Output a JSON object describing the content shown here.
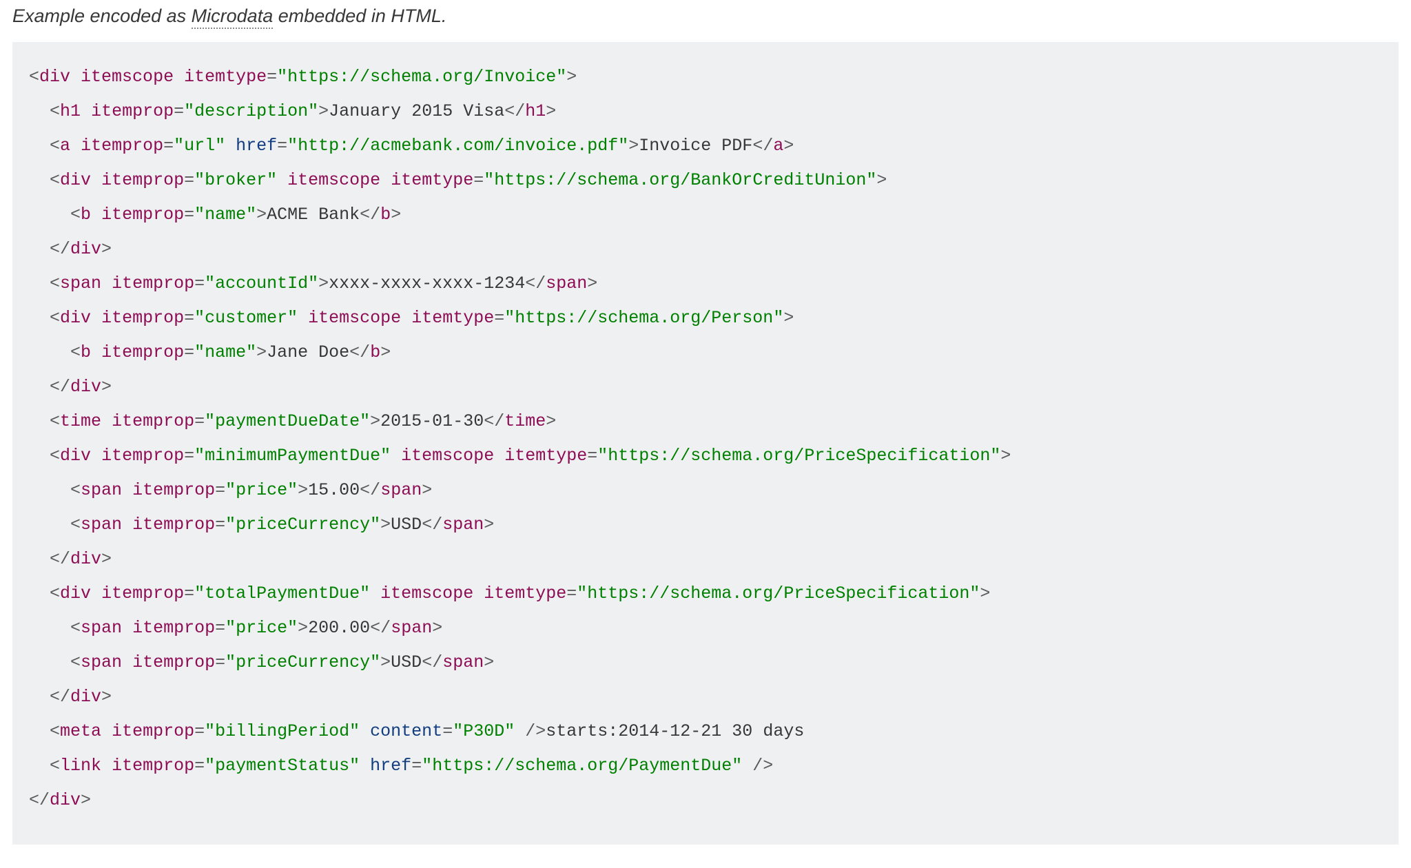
{
  "caption": {
    "prefix": "Example encoded as ",
    "link": "Microdata",
    "suffix": " embedded in HTML."
  },
  "code": {
    "l01": {
      "tag": "div",
      "a1": "itemscope",
      "a2": "itemtype",
      "v2": "\"https://schema.org/Invoice\""
    },
    "l02": {
      "tag": "h1",
      "a1": "itemprop",
      "v1": "\"description\"",
      "text": "January 2015 Visa",
      "close": "h1"
    },
    "l03": {
      "tag": "a",
      "a1": "itemprop",
      "v1": "\"url\"",
      "a2": "href",
      "v2": "\"http://acmebank.com/invoice.pdf\"",
      "text": "Invoice PDF",
      "close": "a"
    },
    "l04": {
      "tag": "div",
      "a1": "itemprop",
      "v1": "\"broker\"",
      "a2": "itemscope",
      "a3": "itemtype",
      "v3": "\"https://schema.org/BankOrCreditUnion\""
    },
    "l05": {
      "tag": "b",
      "a1": "itemprop",
      "v1": "\"name\"",
      "text": "ACME Bank",
      "close": "b"
    },
    "l06": {
      "close": "div"
    },
    "l07": {
      "tag": "span",
      "a1": "itemprop",
      "v1": "\"accountId\"",
      "text": "xxxx-xxxx-xxxx-1234",
      "close": "span"
    },
    "l08": {
      "tag": "div",
      "a1": "itemprop",
      "v1": "\"customer\"",
      "a2": "itemscope",
      "a3": "itemtype",
      "v3": "\"https://schema.org/Person\""
    },
    "l09": {
      "tag": "b",
      "a1": "itemprop",
      "v1": "\"name\"",
      "text": "Jane Doe",
      "close": "b"
    },
    "l10": {
      "close": "div"
    },
    "l11": {
      "tag": "time",
      "a1": "itemprop",
      "v1": "\"paymentDueDate\"",
      "text": "2015-01-30",
      "close": "time"
    },
    "l12": {
      "tag": "div",
      "a1": "itemprop",
      "v1": "\"minimumPaymentDue\"",
      "a2": "itemscope",
      "a3": "itemtype",
      "v3": "\"https://schema.org/PriceSpecification\""
    },
    "l13": {
      "tag": "span",
      "a1": "itemprop",
      "v1": "\"price\"",
      "text": "15.00",
      "close": "span"
    },
    "l14": {
      "tag": "span",
      "a1": "itemprop",
      "v1": "\"priceCurrency\"",
      "text": "USD",
      "close": "span"
    },
    "l15": {
      "close": "div"
    },
    "l16": {
      "tag": "div",
      "a1": "itemprop",
      "v1": "\"totalPaymentDue\"",
      "a2": "itemscope",
      "a3": "itemtype",
      "v3": "\"https://schema.org/PriceSpecification\""
    },
    "l17": {
      "tag": "span",
      "a1": "itemprop",
      "v1": "\"price\"",
      "text": "200.00",
      "close": "span"
    },
    "l18": {
      "tag": "span",
      "a1": "itemprop",
      "v1": "\"priceCurrency\"",
      "text": "USD",
      "close": "span"
    },
    "l19": {
      "close": "div"
    },
    "l20": {
      "tag": "meta",
      "a1": "itemprop",
      "v1": "\"billingPeriod\"",
      "a2": "content",
      "v2": "\"P30D\"",
      "self": "/>",
      "text": "starts:2014-12-21 30 days"
    },
    "l21": {
      "tag": "link",
      "a1": "itemprop",
      "v1": "\"paymentStatus\"",
      "a2": "href",
      "v2": "\"https://schema.org/PaymentDue\"",
      "self": "/>"
    },
    "l22": {
      "close": "div"
    }
  }
}
